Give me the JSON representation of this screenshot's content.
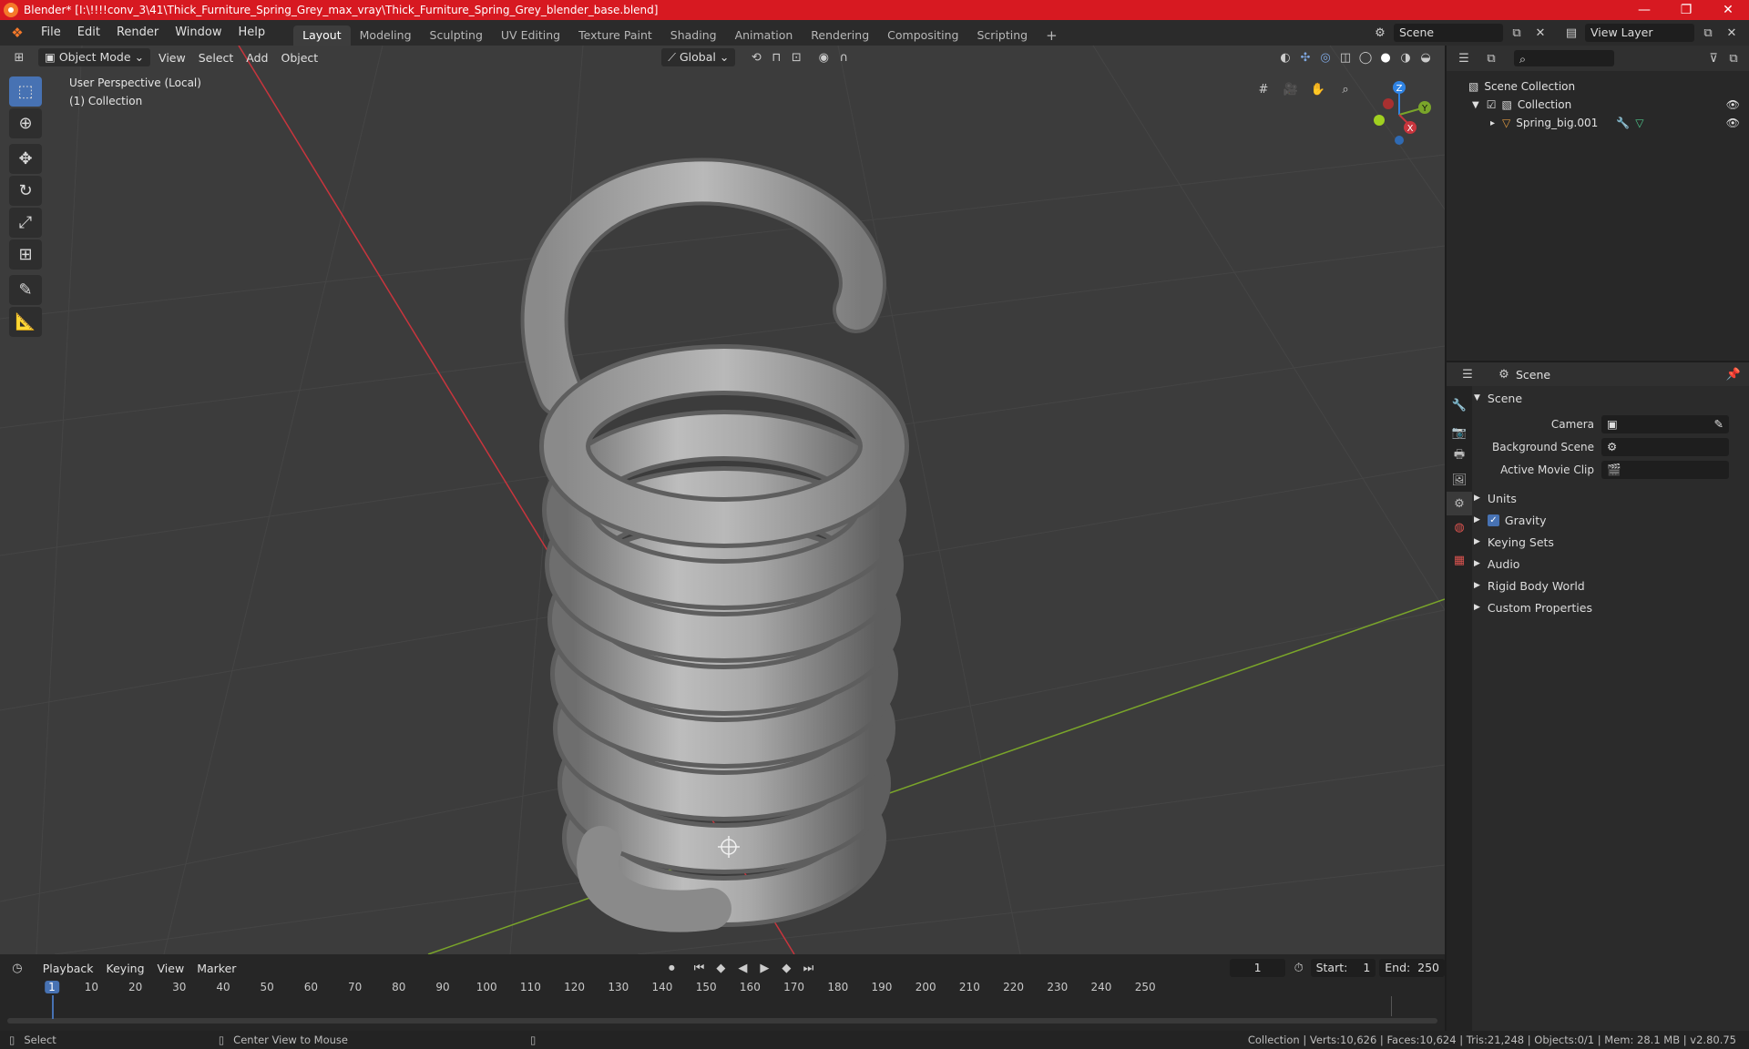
{
  "window": {
    "title": "Blender* [I:\\!!!!conv_3\\41\\Thick_Furniture_Spring_Grey_max_vray\\Thick_Furniture_Spring_Grey_blender_base.blend]",
    "controls": [
      "—",
      "❐",
      "✕"
    ]
  },
  "menu": [
    "File",
    "Edit",
    "Render",
    "Window",
    "Help"
  ],
  "workspaces": [
    {
      "label": "Layout",
      "active": true
    },
    {
      "label": "Modeling"
    },
    {
      "label": "Sculpting"
    },
    {
      "label": "UV Editing"
    },
    {
      "label": "Texture Paint"
    },
    {
      "label": "Shading"
    },
    {
      "label": "Animation"
    },
    {
      "label": "Rendering"
    },
    {
      "label": "Compositing"
    },
    {
      "label": "Scripting"
    }
  ],
  "scene_field": "Scene",
  "view_layer_field": "View Layer",
  "viewport": {
    "mode": "Object Mode",
    "menus": [
      "View",
      "Select",
      "Add",
      "Object"
    ],
    "transform_orientation": "Global",
    "info_line1": "User Perspective (Local)",
    "info_line2": "(1) Collection",
    "gizmo": {
      "z": "Z",
      "y": "Y",
      "x": "X"
    }
  },
  "outliner": {
    "root": "Scene Collection",
    "collection": "Collection",
    "object": "Spring_big.001"
  },
  "properties": {
    "header_title": "Scene",
    "panel": "Scene",
    "camera_label": "Camera",
    "background_scene_label": "Background Scene",
    "active_movie_clip_label": "Active Movie Clip",
    "sections": [
      "Units",
      "Gravity",
      "Keying Sets",
      "Audio",
      "Rigid Body World",
      "Custom Properties"
    ],
    "gravity_checked": true
  },
  "timeline": {
    "menus": [
      "Playback",
      "Keying",
      "View",
      "Marker"
    ],
    "current_frame": "1",
    "start_label": "Start:",
    "start": "1",
    "end_label": "End:",
    "end": "250",
    "ruler": [
      "1",
      "10",
      "20",
      "30",
      "40",
      "50",
      "60",
      "70",
      "80",
      "90",
      "100",
      "110",
      "120",
      "130",
      "140",
      "150",
      "160",
      "170",
      "180",
      "190",
      "200",
      "210",
      "220",
      "230",
      "240",
      "250"
    ]
  },
  "statusbar": {
    "left1": "Select",
    "left2": "Center View to Mouse",
    "right": "Collection | Verts:10,626 | Faces:10,624 | Tris:21,248 | Objects:0/1 | Mem: 28.1 MB | v2.80.75"
  },
  "colors": {
    "title_bar": "#d71921",
    "accent": "#4772b3",
    "x_axis": "#c8353d",
    "y_axis": "#7aa52a",
    "z_axis": "#2f83e3"
  }
}
